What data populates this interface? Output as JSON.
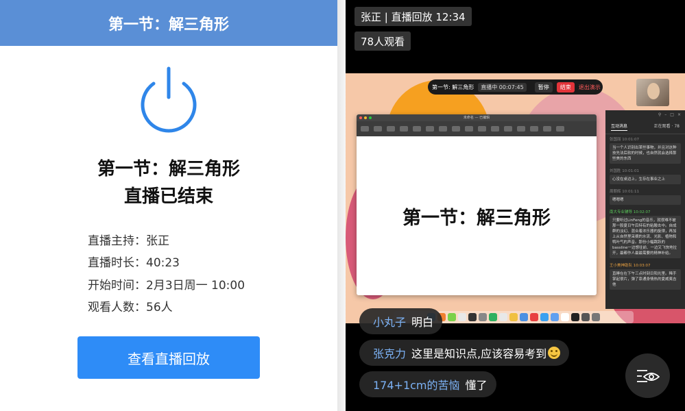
{
  "left": {
    "header_title": "第一节：解三角形",
    "end_title_line1": "第一节：解三角形",
    "end_title_line2": "直播已结束",
    "info": [
      {
        "label": "直播主持：",
        "value": "张正"
      },
      {
        "label": "直播时长：",
        "value": "40:23"
      },
      {
        "label": "开始时间：",
        "value": "2月3日周一 10:00"
      },
      {
        "label": "观看人数：",
        "value": "56人"
      }
    ],
    "replay_button": "查看直播回放",
    "accent_color": "#2e8cf7",
    "header_color": "#5a8fd6"
  },
  "right": {
    "host_tag": "张正 | 直播回放 12:34",
    "viewers_tag": "78人观看",
    "video": {
      "rec_bar": {
        "title": "第一节: 解三角形",
        "status": "直播中",
        "time": "00:07:45",
        "pause": "暂停",
        "stop": "结束",
        "exit": "退出演示"
      },
      "app_window": {
        "title": "未命名 — 已编辑",
        "slide_text": "第一节：解三角形"
      },
      "chat_panel": {
        "tab_interactive": "互动消息",
        "tab_online": "正在观看 · 78",
        "messages": [
          {
            "who": "张国丽  10:01:07",
            "text": "当一个人识别出某些事物，并且对这种技先法后软的时候，也自然就会选择那些美的东西",
            "tone": "grey"
          },
          {
            "who": "刘国胜  10:01:01",
            "text": "心没在桌边上，生存在事业之上",
            "tone": "grey"
          },
          {
            "who": "周朝辉  10:01:11",
            "text": "嗯嗯嗯",
            "tone": "grey"
          },
          {
            "who": "南大专业辅导  10:02:07",
            "text": "只要听过LinFeng的音乐，就很难不被那一股夏日午后特有的粘酸击中。自成群的淡幻、混合着浓乐器的旋律，再加上从自然里采摘的水流、光影、植物和鸭叶气的声音。那份小幅跳跃的bassline一边想往前、一边又飞快地拉开，最都作人最最需要的精神补给。",
            "tone": "green"
          },
          {
            "who": "王小美神助队  10:03:07",
            "text": "直睡在在下午三点时刻日阳光里。稀手掌起很片，弹了靠通身情热的夏威夷吉他",
            "tone": "orange"
          }
        ]
      }
    },
    "comments": [
      {
        "name": "小丸子",
        "text": "明白",
        "emoji": false
      },
      {
        "name": "张克力",
        "text": "这里是知识点,应该容易考到",
        "emoji": true
      },
      {
        "name": "174+1cm的苦恼",
        "text": "懂了",
        "emoji": false
      }
    ]
  }
}
